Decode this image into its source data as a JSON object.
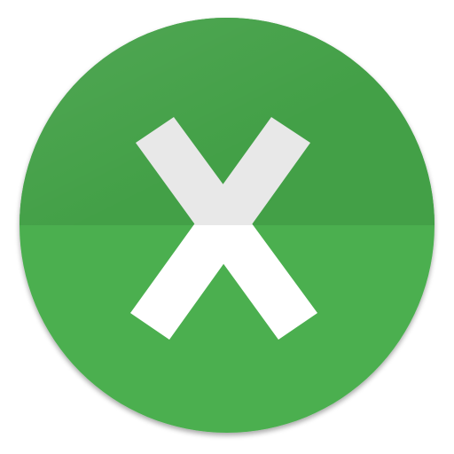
{
  "icon": {
    "name": "close-x-icon",
    "colors": {
      "circle_top": "#43a047",
      "circle_bottom": "#4caf50",
      "x_top": "#e8e8e8",
      "x_bottom": "#ffffff",
      "shadow": "#2e7d32"
    }
  }
}
